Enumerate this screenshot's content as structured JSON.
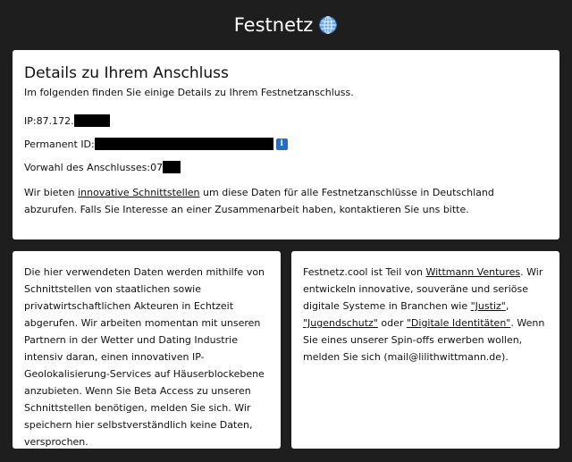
{
  "header": {
    "title": "Festnetz",
    "icon": "globe-icon"
  },
  "details": {
    "heading": "Details zu Ihrem Anschluss",
    "subtitle": "Im folgenden finden Sie einige Details zu Ihrem Festnetzanschluss.",
    "ip_label": "IP: ",
    "ip_value": "87.172.",
    "permanent_id_label": "Permanent ID:",
    "info_icon": "i",
    "vorwahl_label": "Vorwahl des Anschlusses: ",
    "vorwahl_value": "07",
    "offer_text_1": "Wir bieten ",
    "offer_link": "innovative Schnittstellen",
    "offer_text_2": " um diese Daten für alle Festnetzanschlüsse in Deutschland abzurufen. Falls Sie Interesse an einer Zusammenarbeit haben, kontaktieren Sie uns bitte."
  },
  "left_card": {
    "text": "Die hier verwendeten Daten werden mithilfe von Schnittstellen von staatlichen sowie privatwirtschaftlichen Akteuren in Echtzeit abgerufen. Wir arbeiten momentan mit unseren Partnern in der Wetter und Dating Industrie intensiv daran, einen innovativen IP-Geolokalisierung-Services auf Häuserblockebene anzubieten. Wenn Sie Beta Access zu unseren Schnittstellen benötigen, melden Sie sich. Wir speichern hier selbstverständlich keine Daten, versprochen."
  },
  "right_card": {
    "text_1": "Festnetz.cool ist Teil von ",
    "link_wittmann": "Wittmann Ventures",
    "text_2": ". Wir entwickeln innovative, souveräne und seriöse digitale Systeme in Branchen wie ",
    "link_justiz": "\"Justiz\"",
    "text_3": ", ",
    "link_jugendschutz": "\"Jugendschutz\"",
    "text_4": " oder ",
    "link_identitaeten": "\"Digitale Identitäten\"",
    "text_5": ". Wenn Sie eines unserer Spin-offs erwerben wollen, melden Sie sich (mail@lilithwittmann.de)."
  },
  "colors": {
    "background": "#1e1e1e",
    "card": "#ffffff",
    "info_icon": "#1e6fd0",
    "redaction": "#000000"
  }
}
